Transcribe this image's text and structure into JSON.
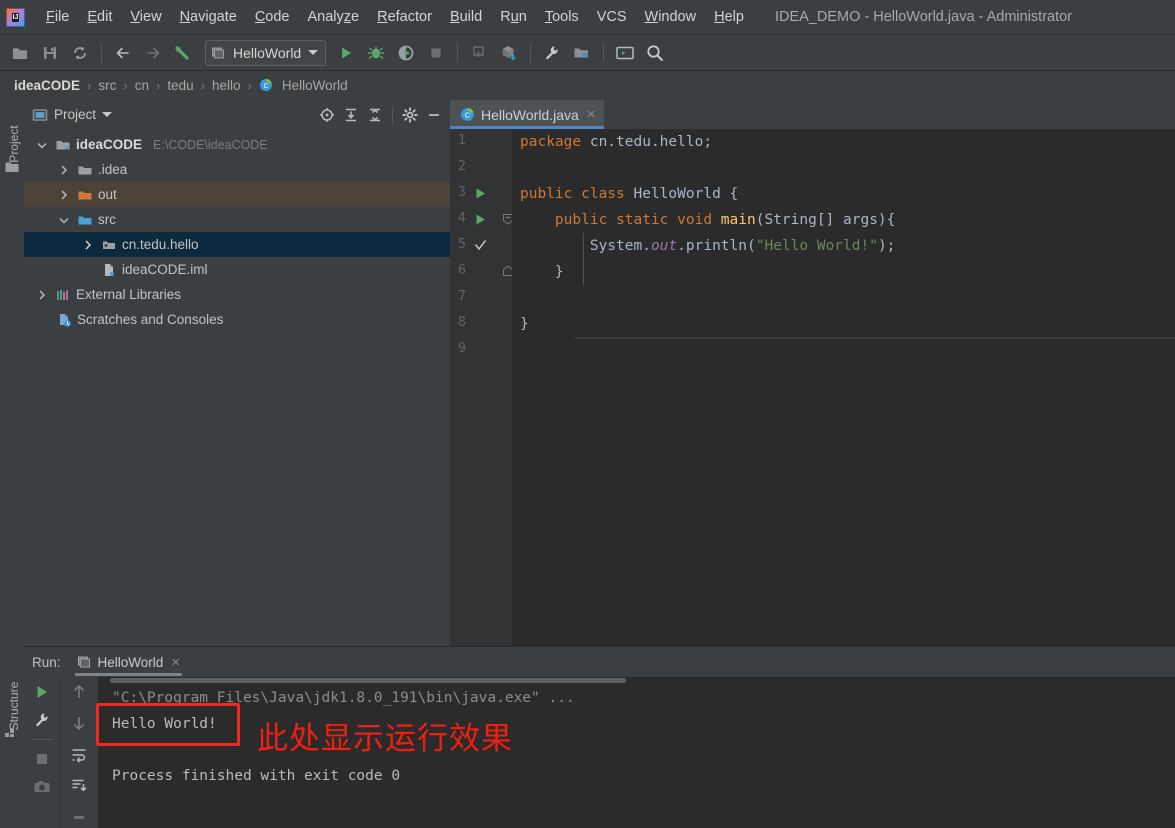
{
  "window": {
    "title": "IDEA_DEMO - HelloWorld.java - Administrator",
    "logo_text": "IJ"
  },
  "menubar": {
    "items": [
      {
        "label": "File",
        "mnemonic": "F"
      },
      {
        "label": "Edit",
        "mnemonic": "E"
      },
      {
        "label": "View",
        "mnemonic": "V"
      },
      {
        "label": "Navigate",
        "mnemonic": "N"
      },
      {
        "label": "Code",
        "mnemonic": "C"
      },
      {
        "label": "Analyze",
        "mnemonic": ""
      },
      {
        "label": "Refactor",
        "mnemonic": "R"
      },
      {
        "label": "Build",
        "mnemonic": "B"
      },
      {
        "label": "Run",
        "mnemonic": "u"
      },
      {
        "label": "Tools",
        "mnemonic": "T"
      },
      {
        "label": "VCS",
        "mnemonic": ""
      },
      {
        "label": "Window",
        "mnemonic": "W"
      },
      {
        "label": "Help",
        "mnemonic": "H"
      }
    ]
  },
  "toolbar": {
    "open_icon": "open-folder-icon",
    "save_icon": "save-icon",
    "sync_icon": "refresh-icon",
    "back_icon": "arrow-left-icon",
    "forward_icon": "arrow-right-icon",
    "last_edit_icon": "last-edit-location-icon",
    "run_config": "HelloWorld",
    "run_icon": "run-icon",
    "debug_icon": "debug-bug-icon",
    "run_coverage_icon": "run-with-coverage-icon",
    "stop_icon": "stop-icon",
    "update_icon": "update-project-icon",
    "build_artifact_icon": "build-artifact-icon",
    "settings_icon": "wrench-settings-icon",
    "project_structure_icon": "project-structure-icon",
    "terminal_icon": "terminal-icon",
    "search_icon": "search-everywhere-icon"
  },
  "breadcrumb": {
    "items": [
      "ideaCODE",
      "src",
      "cn",
      "tedu",
      "hello",
      "HelloWorld"
    ],
    "separator": "›",
    "last_icon": "java-class-icon"
  },
  "sidebar_left": {
    "top_tab": "Project",
    "bottom_tab": "Structure",
    "top_icon": "project-tool-window-icon",
    "bottom_icon": "structure-tool-window-icon"
  },
  "project_panel": {
    "title": "Project",
    "title_icon": "project-view-icon",
    "caret_icon": "chevron-down-icon",
    "actions": [
      {
        "name": "scroll-from-source-icon"
      },
      {
        "name": "expand-all-icon"
      },
      {
        "name": "collapse-all-icon"
      },
      {
        "name": "gear-settings-icon"
      },
      {
        "name": "hide-panel-icon"
      }
    ],
    "tree": [
      {
        "label": "ideaCODE",
        "path": "E:\\CODE\\ideaCODE",
        "indent": 0,
        "arrow": "down",
        "icon": "project-root-icon",
        "bold": true,
        "state": "normal"
      },
      {
        "label": ".idea",
        "path": "",
        "indent": 1,
        "arrow": "right",
        "icon": "folder-icon",
        "bold": false,
        "state": "normal"
      },
      {
        "label": "out",
        "path": "",
        "indent": 1,
        "arrow": "right",
        "icon": "folder-orange-icon",
        "bold": false,
        "state": "highlight"
      },
      {
        "label": "src",
        "path": "",
        "indent": 1,
        "arrow": "down",
        "icon": "folder-source-icon",
        "bold": false,
        "state": "normal"
      },
      {
        "label": "cn.tedu.hello",
        "path": "",
        "indent": 2,
        "arrow": "right",
        "icon": "package-icon",
        "bold": false,
        "state": "selected"
      },
      {
        "label": "ideaCODE.iml",
        "path": "",
        "indent": 2,
        "arrow": "none",
        "icon": "iml-file-icon",
        "bold": false,
        "state": "normal"
      },
      {
        "label": "External Libraries",
        "path": "",
        "indent": 0,
        "arrow": "right",
        "icon": "libraries-icon",
        "bold": false,
        "state": "normal"
      },
      {
        "label": "Scratches and Consoles",
        "path": "",
        "indent": 0,
        "arrow": "none",
        "icon": "scratches-icon",
        "bold": false,
        "state": "normal"
      }
    ]
  },
  "editor": {
    "tab": {
      "label": "HelloWorld.java",
      "icon": "java-class-icon",
      "close": "×"
    },
    "lines": [
      {
        "num": "1",
        "gutter_marker": "",
        "tokens": [
          {
            "t": "kw",
            "v": "package"
          },
          {
            "t": "pl",
            "v": " cn.tedu.hello;"
          }
        ]
      },
      {
        "num": "2",
        "gutter_marker": "",
        "tokens": []
      },
      {
        "num": "3",
        "gutter_marker": "run",
        "tokens": [
          {
            "t": "kw",
            "v": "public class"
          },
          {
            "t": "pl",
            "v": " HelloWorld {"
          }
        ]
      },
      {
        "num": "4",
        "gutter_marker": "run",
        "fold": "fold-open",
        "tokens": [
          {
            "t": "pl",
            "v": "    "
          },
          {
            "t": "kw",
            "v": "public static void"
          },
          {
            "t": "mth",
            "v": " main"
          },
          {
            "t": "pl",
            "v": "(String[] args){"
          }
        ]
      },
      {
        "num": "5",
        "gutter_marker": "check",
        "tokens": [
          {
            "t": "pl",
            "v": "        System."
          },
          {
            "t": "fld",
            "v": "out"
          },
          {
            "t": "pl",
            "v": ".println("
          },
          {
            "t": "str",
            "v": "\"Hello World!\""
          },
          {
            "t": "pl",
            "v": ");"
          }
        ]
      },
      {
        "num": "6",
        "gutter_marker": "",
        "fold": "fold-end",
        "tokens": [
          {
            "t": "pl",
            "v": "    }"
          }
        ]
      },
      {
        "num": "7",
        "gutter_marker": "",
        "tokens": []
      },
      {
        "num": "8",
        "gutter_marker": "",
        "tokens": [
          {
            "t": "pl",
            "v": "}"
          }
        ]
      },
      {
        "num": "9",
        "gutter_marker": "",
        "tokens": []
      }
    ]
  },
  "run_panel": {
    "label": "Run:",
    "tab_label": "HelloWorld",
    "tab_icon": "run-config-icon",
    "tab_close": "×",
    "tools_left": [
      {
        "name": "rerun-icon"
      },
      {
        "name": "wrench-icon"
      },
      {
        "name": "stop-icon"
      },
      {
        "name": "camera-snapshot-icon"
      }
    ],
    "tools_right": [
      {
        "name": "arrow-up-icon"
      },
      {
        "name": "arrow-down-icon"
      },
      {
        "name": "soft-wrap-icon"
      },
      {
        "name": "scroll-to-end-icon"
      },
      {
        "name": "print-icon"
      }
    ],
    "console": [
      {
        "text": "\"C:\\Program Files\\Java\\jdk1.8.0_191\\bin\\java.exe\" ...",
        "style": "cmd"
      },
      {
        "text": "Hello World!",
        "style": "out"
      },
      {
        "text": "",
        "style": "out"
      },
      {
        "text": "Process finished with exit code 0",
        "style": "out"
      }
    ]
  },
  "annotation": {
    "text": "此处显示运行效果",
    "color": "#f01f10",
    "highlight_box_target": "Hello World!"
  },
  "colors": {
    "background": "#3c3f41",
    "editor_bg": "#2b2b2b",
    "gutter_bg": "#313335",
    "selection": "#0d293e",
    "highlight_row": "#4b4337",
    "tab_active": "#4e5254",
    "tab_underline": "#4a88c7",
    "keyword": "#cc7832",
    "string": "#6a8759",
    "field": "#9876aa",
    "method": "#ffc66d",
    "plain": "#a9b7c6",
    "annotation_red": "#f01f10",
    "green_run": "#59a869"
  }
}
